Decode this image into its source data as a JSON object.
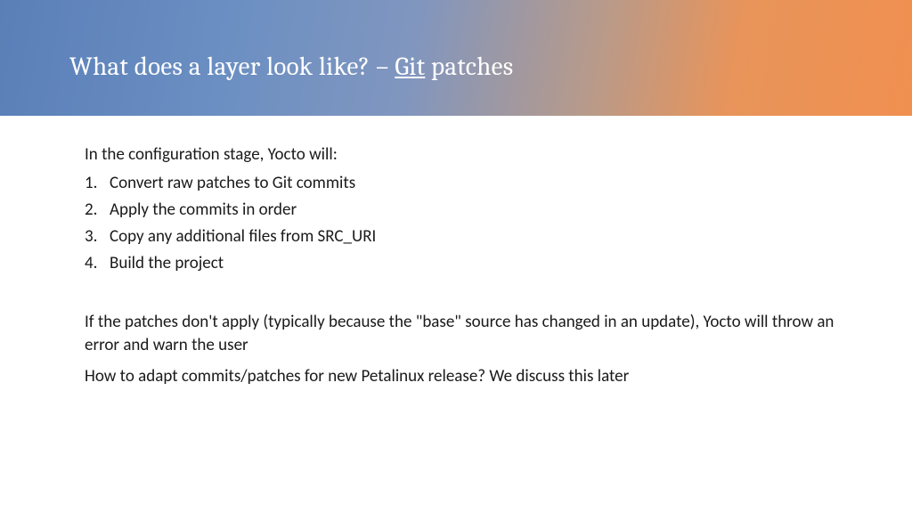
{
  "header": {
    "title_prefix": "What does a layer look like? – ",
    "title_underlined": "Git",
    "title_suffix": " patches"
  },
  "content": {
    "intro": "In the configuration stage, Yocto will:",
    "steps": [
      "Convert raw patches to Git commits",
      "Apply the commits in order",
      "Copy any additional files from SRC_URI",
      "Build the project"
    ],
    "para1": "If the patches don't apply (typically because the \"base\" source has changed in an update), Yocto will throw an error and warn the user",
    "para2": "How to adapt commits/patches for new Petalinux release? We discuss this later"
  }
}
